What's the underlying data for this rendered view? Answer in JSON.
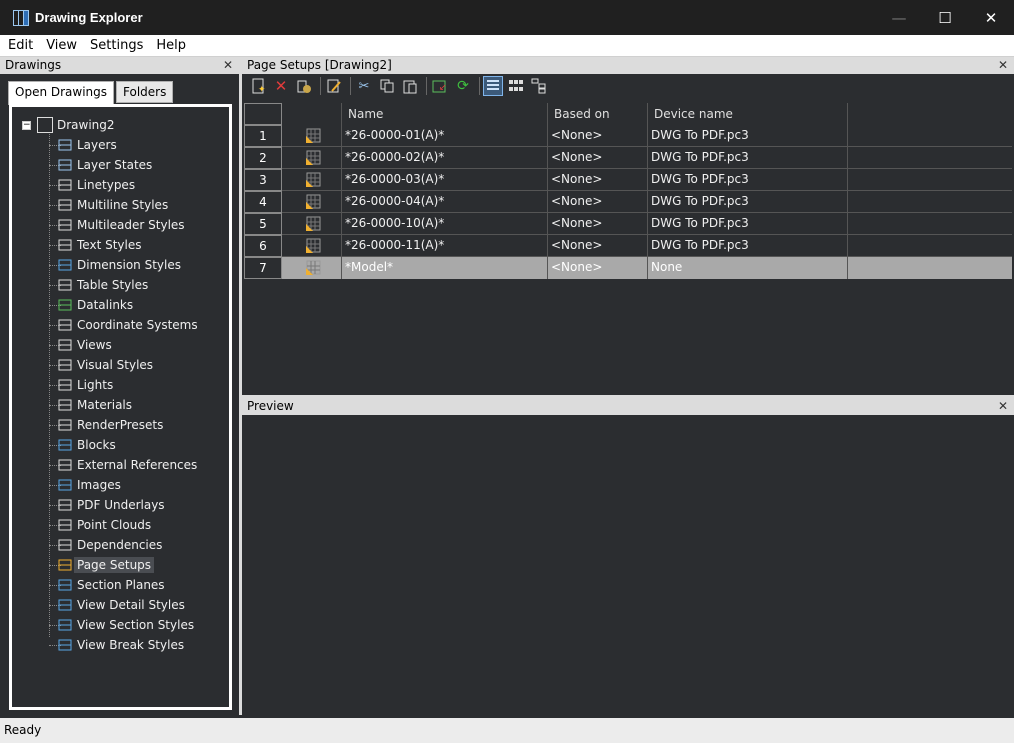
{
  "window": {
    "title": "Drawing Explorer",
    "min": "—",
    "max": "☐",
    "close": "✕"
  },
  "menu": [
    "Edit",
    "View",
    "Settings",
    "Help"
  ],
  "drawings_panel": {
    "title": "Drawings",
    "tabs": [
      "Open Drawings",
      "Folders"
    ],
    "root": "Drawing2",
    "items": [
      "Layers",
      "Layer States",
      "Linetypes",
      "Multiline Styles",
      "Multileader Styles",
      "Text Styles",
      "Dimension Styles",
      "Table Styles",
      "Datalinks",
      "Coordinate Systems",
      "Views",
      "Visual Styles",
      "Lights",
      "Materials",
      "RenderPresets",
      "Blocks",
      "External References",
      "Images",
      "PDF Underlays",
      "Point Clouds",
      "Dependencies",
      "Page Setups",
      "Section Planes",
      "View Detail Styles",
      "View Section Styles",
      "View Break Styles"
    ],
    "selected": "Page Setups"
  },
  "page_setups": {
    "title": "Page Setups [Drawing2]",
    "columns": [
      "Name",
      "Based on",
      "Device name"
    ],
    "rows": [
      {
        "num": "1",
        "name": "*26-0000-01(A)*",
        "based_on": "<None>",
        "device": "DWG To PDF.pc3"
      },
      {
        "num": "2",
        "name": "*26-0000-02(A)*",
        "based_on": "<None>",
        "device": "DWG To PDF.pc3"
      },
      {
        "num": "3",
        "name": "*26-0000-03(A)*",
        "based_on": "<None>",
        "device": "DWG To PDF.pc3"
      },
      {
        "num": "4",
        "name": "*26-0000-04(A)*",
        "based_on": "<None>",
        "device": "DWG To PDF.pc3"
      },
      {
        "num": "5",
        "name": "*26-0000-10(A)*",
        "based_on": "<None>",
        "device": "DWG To PDF.pc3"
      },
      {
        "num": "6",
        "name": "*26-0000-11(A)*",
        "based_on": "<None>",
        "device": "DWG To PDF.pc3"
      },
      {
        "num": "7",
        "name": "*Model*",
        "based_on": "<None>",
        "device": "None"
      }
    ],
    "selected_row": "7"
  },
  "preview": {
    "title": "Preview"
  },
  "status": "Ready",
  "close_glyph": "✕"
}
